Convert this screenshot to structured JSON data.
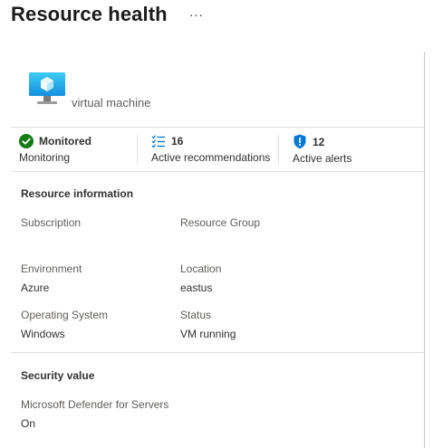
{
  "header": {
    "title": "Resource health",
    "more_label": "···"
  },
  "resource": {
    "type_label": "virtual machine"
  },
  "stats": {
    "monitoring": {
      "value": "Monitored",
      "label": "Monitoring"
    },
    "recommendations": {
      "value": "16",
      "label": "Active recommendations"
    },
    "alerts": {
      "value": "12",
      "label": "Active alerts"
    }
  },
  "resource_info": {
    "title": "Resource information",
    "subscription": {
      "label": "Subscription",
      "value": ""
    },
    "resource_group": {
      "label": "Resource Group",
      "value": ""
    },
    "environment": {
      "label": "Environment",
      "value": "Azure"
    },
    "location": {
      "label": "Location",
      "value": "eastus"
    },
    "os": {
      "label": "Operating System",
      "value": "Windows"
    },
    "status": {
      "label": "Status",
      "value": "VM running"
    }
  },
  "security": {
    "title": "Security value",
    "defender": {
      "label": "Microsoft Defender for Servers",
      "value": "On"
    }
  },
  "colors": {
    "success": "#107c10",
    "brand": "#0078d4",
    "divider": "#e1dfdd"
  }
}
